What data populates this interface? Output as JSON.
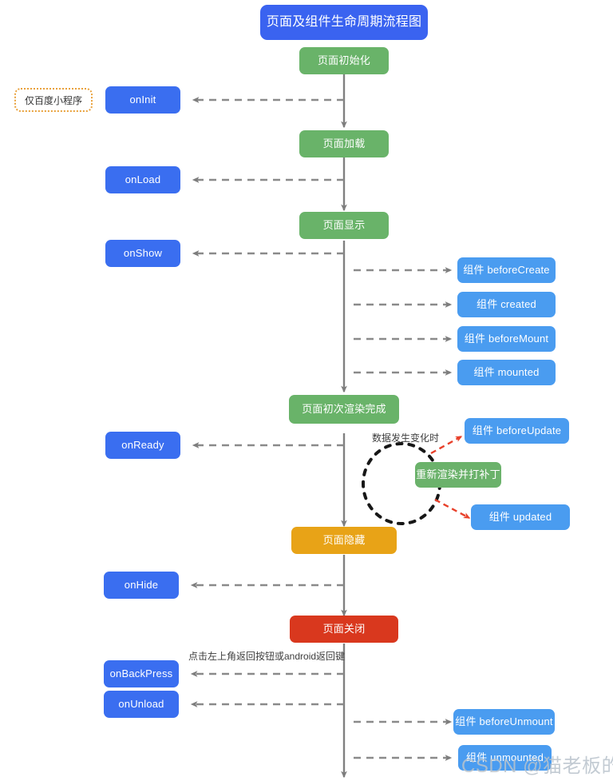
{
  "diagram": {
    "title": "页面及组件生命周期流程图",
    "title_color": "#3a63f0",
    "palette": {
      "green": "#69b369",
      "orange": "#e8a317",
      "red": "#d9381e",
      "blue_page_hook": "#3a6ef0",
      "blue_component": "#4a9cf0",
      "badge_border": "#e9a13b",
      "arrow_gray": "#808080",
      "arrow_red": "#e8402a",
      "ellipse_black": "#1a1a1a"
    },
    "badge": {
      "label": "仅百度小程序"
    },
    "main_flow": [
      {
        "id": "page-init",
        "label": "页面初始化",
        "color": "green"
      },
      {
        "id": "page-load",
        "label": "页面加载",
        "color": "green"
      },
      {
        "id": "page-show",
        "label": "页面显示",
        "color": "green"
      },
      {
        "id": "page-first-render",
        "label": "页面初次渲染完成",
        "color": "green"
      },
      {
        "id": "page-hide",
        "label": "页面隐藏",
        "color": "orange"
      },
      {
        "id": "page-close",
        "label": "页面关闭",
        "color": "red"
      }
    ],
    "page_hooks": [
      {
        "id": "onInit",
        "label": "onInit"
      },
      {
        "id": "onLoad",
        "label": "onLoad"
      },
      {
        "id": "onShow",
        "label": "onShow"
      },
      {
        "id": "onReady",
        "label": "onReady"
      },
      {
        "id": "onHide",
        "label": "onHide"
      },
      {
        "id": "onBackPress",
        "label": "onBackPress"
      },
      {
        "id": "onUnload",
        "label": "onUnload"
      }
    ],
    "component_hooks": [
      {
        "id": "beforeCreate",
        "label": "组件 beforeCreate"
      },
      {
        "id": "created",
        "label": "组件 created"
      },
      {
        "id": "beforeMount",
        "label": "组件 beforeMount"
      },
      {
        "id": "mounted",
        "label": "组件 mounted"
      },
      {
        "id": "beforeUpdate",
        "label": "组件 beforeUpdate"
      },
      {
        "id": "updated",
        "label": "组件 updated"
      },
      {
        "id": "beforeUnmount",
        "label": "组件 beforeUnmount"
      },
      {
        "id": "unmounted",
        "label": "组件 unmounted"
      }
    ],
    "update_loop": {
      "trigger_label": "数据发生变化时",
      "rerender_label": "重新渲染并打补丁"
    },
    "edge_labels": {
      "back_press": "点击左上角返回按钮或android返回键"
    },
    "watermark": "CSDN @猫老板的豆"
  }
}
